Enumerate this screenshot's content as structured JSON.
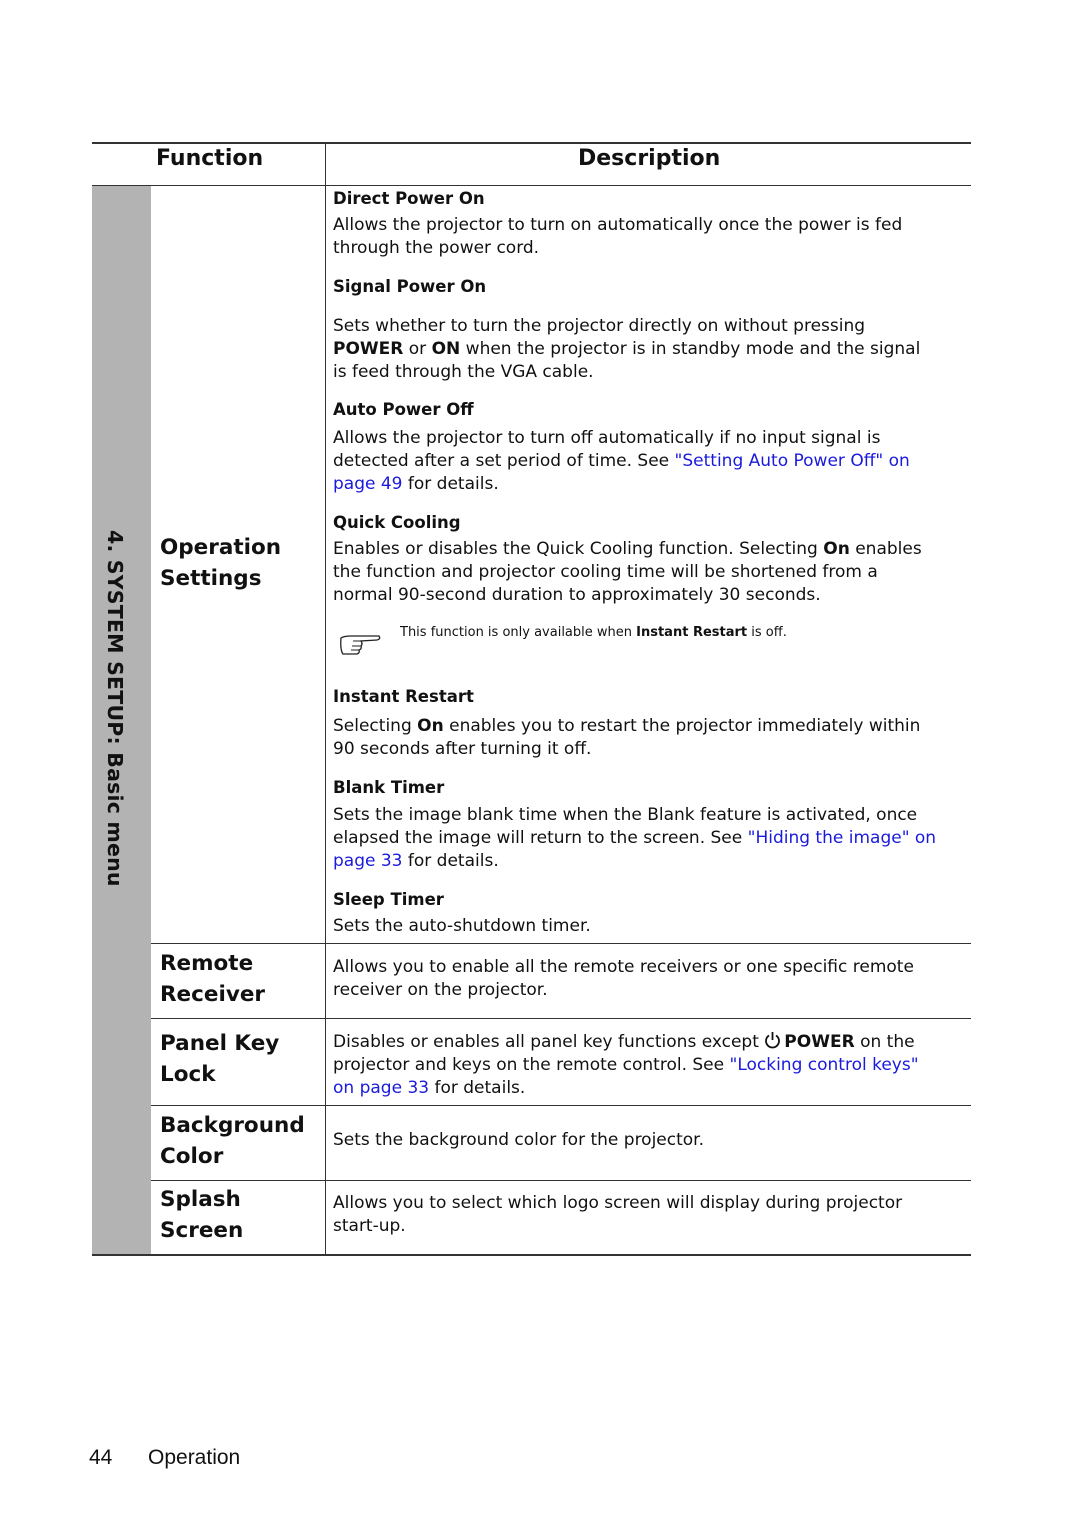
{
  "table": {
    "header": {
      "function": "Function",
      "description": "Description"
    },
    "section_label": "4. SYSTEM SETUP: Basic menu",
    "rows": [
      {
        "function": [
          "Operation",
          "Settings"
        ],
        "items": [
          {
            "title": "Direct Power On",
            "lines": [
              "Allows the projector to turn on automatically once the power is fed",
              "through the power cord."
            ]
          },
          {
            "title": "Signal Power On",
            "line1": "Sets whether to turn the projector directly on without pressing",
            "line2_b1": "POWER",
            "line2_t1": " or ",
            "line2_b2": "ON",
            "line2_t2": " when the projector is in standby mode and the signal",
            "line3": "is feed through the VGA cable."
          },
          {
            "title": "Auto Power Off",
            "line1": "Allows the projector to turn off automatically if no input signal is",
            "line2_text": "detected after a set period of time. See ",
            "link": "\"Setting Auto Power Off\" on",
            "link2": "page 49",
            "line3_text": " for details."
          },
          {
            "title": "Quick Cooling",
            "line1_text": "Enables or disables the Quick Cooling function. Selecting ",
            "line1_bold": "On",
            "line1_end": " enables",
            "line2": "the function and projector cooling time will be shortened from a",
            "line3": "normal 90-second duration to approximately 30 seconds.",
            "note_text": "This function is only available when ",
            "note_bold": "Instant Restart",
            "note_end": " is off."
          },
          {
            "title": "Instant Restart",
            "line1_text": "Selecting ",
            "line1_bold": "On",
            "line1_end": " enables you to restart the projector immediately within",
            "line2": "90 seconds after turning it off."
          },
          {
            "title": "Blank Timer",
            "line1": "Sets the image blank time when the Blank feature is activated, once",
            "line2_text": "elapsed the image will return to the screen. See ",
            "link": "\"Hiding the image\" on",
            "link2": "page 33",
            "line3_text": " for details."
          },
          {
            "title": "Sleep Timer",
            "line1": "Sets the auto-shutdown timer."
          }
        ]
      },
      {
        "function": [
          "Remote",
          "Receiver"
        ],
        "lines": [
          "Allows you to enable all the remote receivers or one specific remote",
          "receiver on the projector."
        ]
      },
      {
        "function": [
          "Panel Key",
          "Lock"
        ],
        "line1_text": "Disables or enables all panel key functions except ",
        "icon": "power-icon",
        "line1_bold": "POWER",
        "line1_end": " on the",
        "line2_text": "projector and keys on the remote control. See ",
        "link": "\"Locking control keys\"",
        "link2": "on page 33",
        "line3_text": " for details."
      },
      {
        "function": [
          "Background",
          "Color"
        ],
        "lines": [
          "Sets the background color for the projector."
        ]
      },
      {
        "function": [
          "Splash",
          "Screen"
        ],
        "lines": [
          "Allows you to select which logo screen will display during projector",
          "start-up."
        ]
      }
    ]
  },
  "footer": {
    "page_number": "44",
    "section": "Operation"
  },
  "colors": {
    "link": "#1a1adc",
    "sidebar": "#b3b3b3",
    "rule": "#333333"
  },
  "icons": {
    "note": "pointing-hand-icon",
    "power": "power-icon"
  }
}
